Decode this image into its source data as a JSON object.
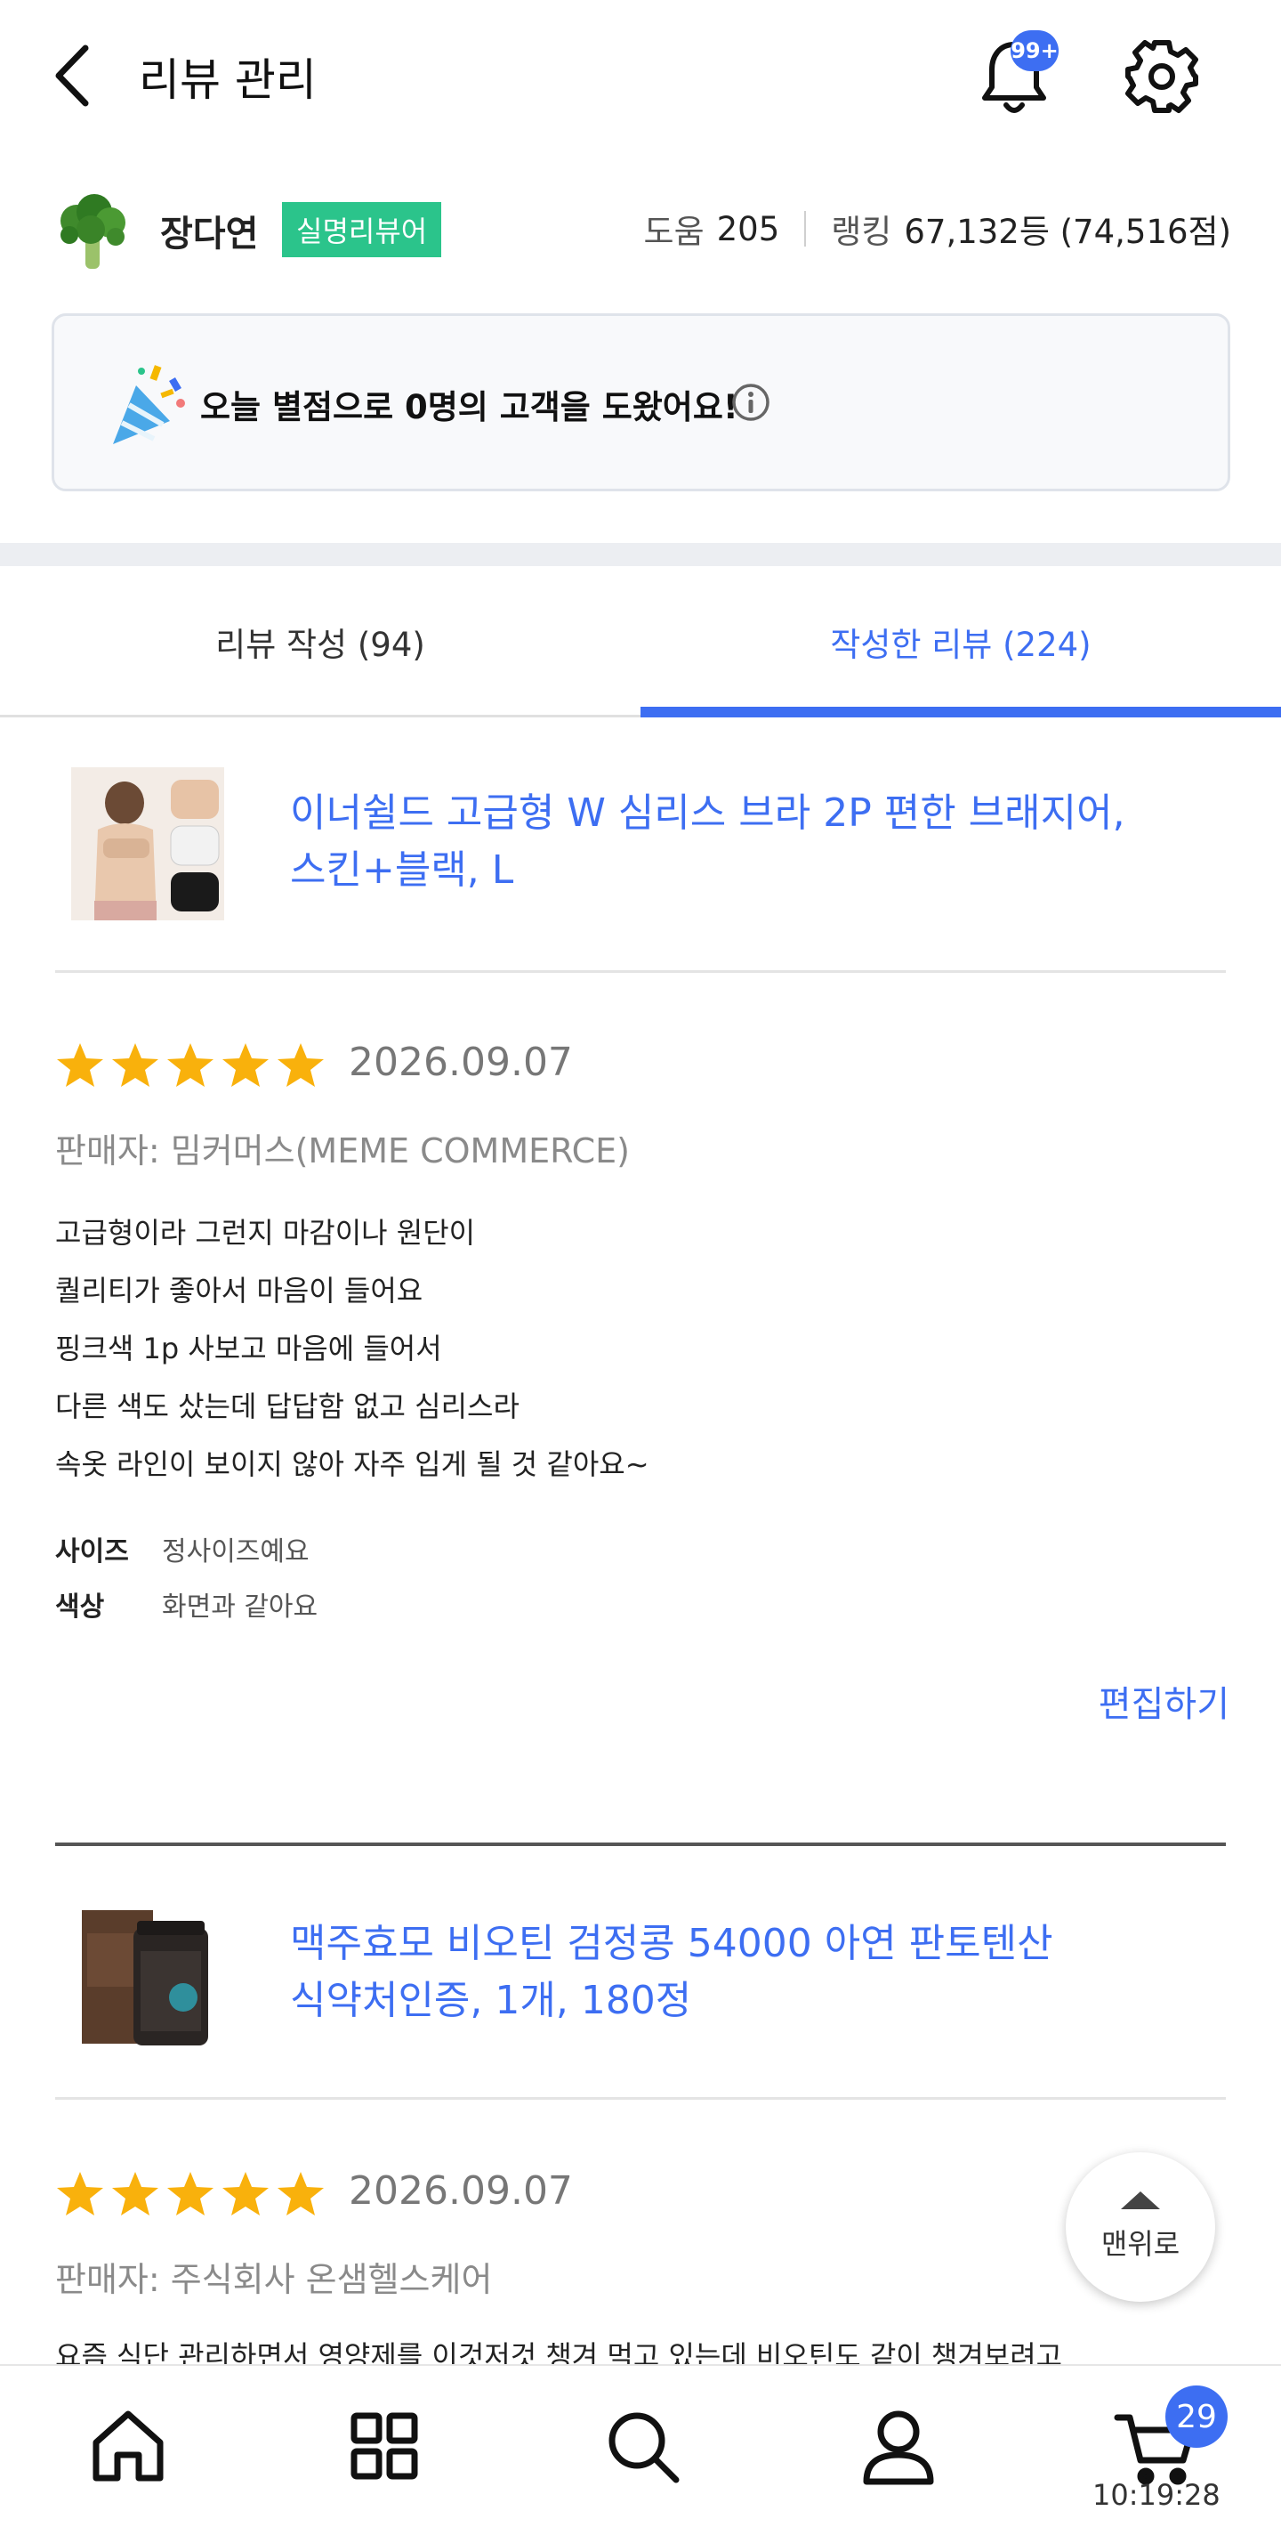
{
  "header": {
    "title": "리뷰 관리",
    "notification_badge": "99+"
  },
  "profile": {
    "name": "장다연",
    "badge": "실명리뷰어",
    "help_label": "도움",
    "help_value": "205",
    "rank_label": "랭킹",
    "rank_value": "67,132등 (74,516점)"
  },
  "banner": {
    "text": "오늘 별점으로 0명의 고객을 도왔어요!"
  },
  "tabs": [
    {
      "label": "리뷰 작성 (94)",
      "active": false
    },
    {
      "label": "작성한 리뷰 (224)",
      "active": true
    }
  ],
  "reviews": [
    {
      "product_name_line1": "이너쉴드 고급형 W 심리스 브라 2P 편한 브래지어,",
      "product_name_line2": "스킨+블랙, L",
      "rating": 5,
      "date": "2026.09.07",
      "seller": "판매자: 밈커머스(MEME COMMERCE)",
      "lines": [
        "고급형이라 그런지 마감이나 원단이",
        "퀄리티가  좋아서 마음이 들어요",
        "핑크색 1p 사보고 마음에 들어서",
        "다른 색도 샀는데 답답함 없고 심리스라",
        "속옷 라인이 보이지 않아 자주 입게 될 것 같아요~"
      ],
      "attributes": [
        {
          "key": "사이즈",
          "value": "정사이즈예요"
        },
        {
          "key": "색상",
          "value": "화면과 같아요"
        }
      ],
      "edit_label": "편집하기"
    },
    {
      "product_name_line1": "맥주효모 비오틴 검정콩 54000 아연 판토텐산",
      "product_name_line2": "식약처인증, 1개, 180정",
      "rating": 5,
      "date": "2026.09.07",
      "seller": "판매자: 주식회사 온샘헬스케어",
      "first_line_partial": "요즘 식단 관리하면서 영양제를 이것저것 챙겨 먹고 있는데 비오틴도 같이 챙겨보려고"
    }
  ],
  "floating": {
    "top_label": "맨위로"
  },
  "bottom_nav": {
    "cart_count": "29",
    "clock": "10:19:28"
  },
  "colors": {
    "accent": "#3d6ef2",
    "badge_green": "#2bc48b",
    "star": "#f9b10c"
  }
}
